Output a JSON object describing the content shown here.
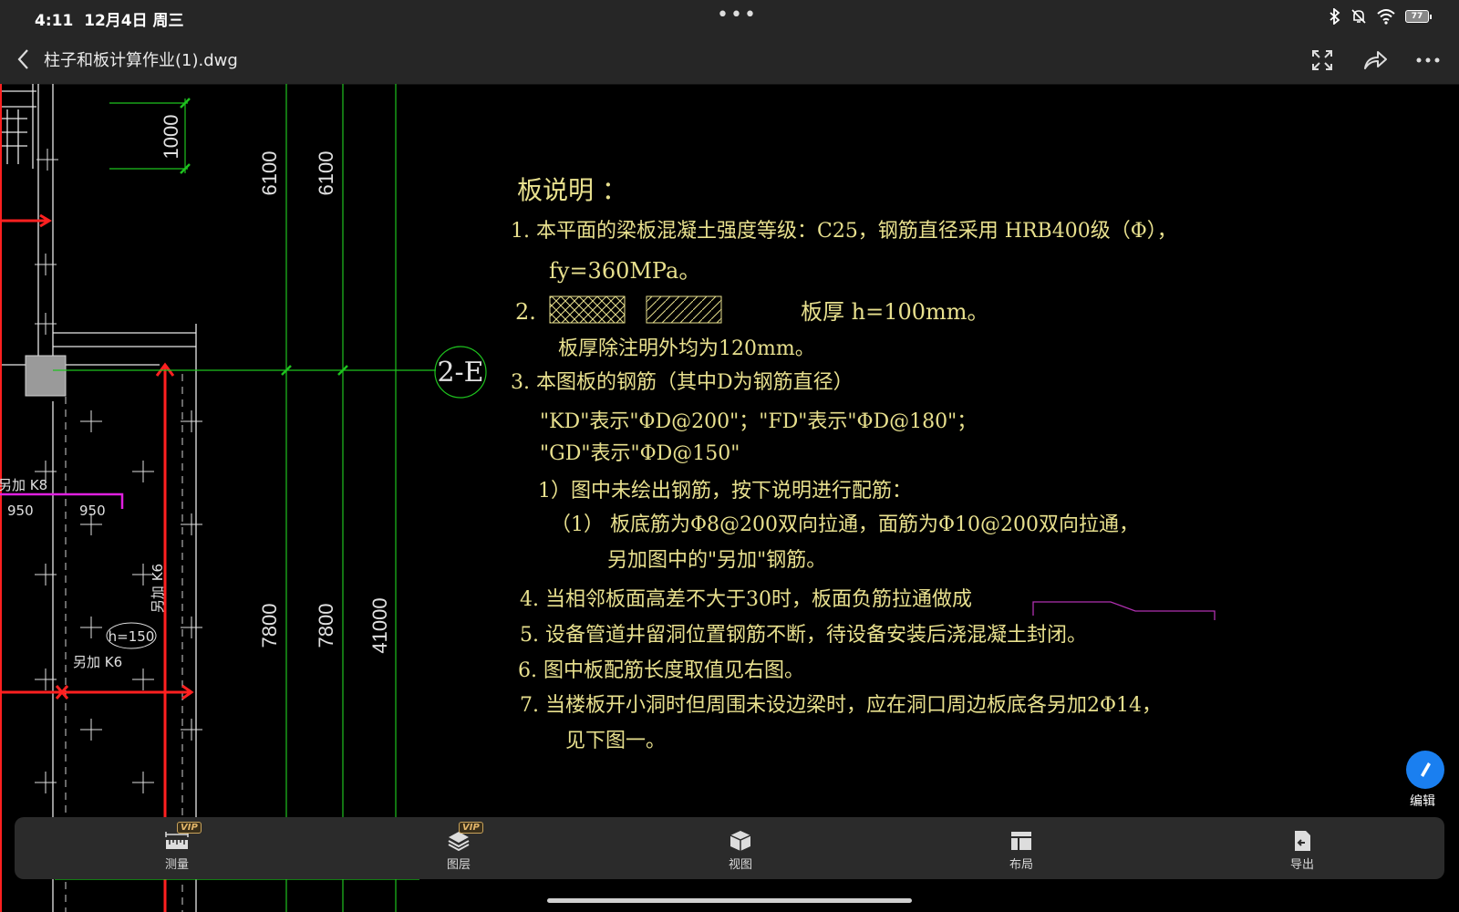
{
  "status_bar": {
    "time": "4:11",
    "date": "12月4日 周三",
    "dots": "•••",
    "battery": "77",
    "icons": [
      "bluetooth-icon",
      "mute-icon",
      "wifi-icon",
      "battery-icon"
    ]
  },
  "titlebar": {
    "file_name": "柱子和板计算作业(1).dwg",
    "actions": [
      "fullscreen-icon",
      "share-icon",
      "more-icon"
    ]
  },
  "drawing": {
    "dim_top": "1000",
    "dim_6100_a": "6100",
    "dim_6100_b": "6100",
    "dim_7800_a": "7800",
    "dim_7800_b": "7800",
    "dim_41000": "41000",
    "axis_label": "2-E",
    "label_k8": "另加 K8",
    "label_950_a": "950",
    "label_950_b": "950",
    "label_k6_v": "另加 K6",
    "label_h150": "h=150",
    "label_k6_h": "另加 K6",
    "colors": {
      "red": "#ff2020",
      "green": "#1ec21e",
      "magenta": "#e020e0",
      "yellow_text": "#e8e08e"
    }
  },
  "notes": {
    "title": "板说明 ：",
    "l1": "1.   本平面的梁板混凝土强度等级：C25，钢筋直径采用  HRB400级（Φ），",
    "l1b": "fy=360MPa。",
    "l2_num": "2.",
    "l2_text": "板厚  h=100mm。",
    "l2b": "板厚除注明外均为120mm。",
    "l3": "3.   本图板的钢筋（其中D为钢筋直径）",
    "l3a": "\"KD\"表示\"ΦD@200\"；\"FD\"表示\"ΦD@180\"；",
    "l3b": "\"GD\"表示\"ΦD@150\"",
    "l3c": "1）图中未绘出钢筋，按下说明进行配筋：",
    "l3d": "（1）  板底筋为Φ8@200双向拉通，面筋为Φ10@200双向拉通，",
    "l3e": "另加图中的\"另加\"钢筋。",
    "l4": "4.   当相邻板面高差不大于30时，板面负筋拉通做成",
    "l5": "5.   设备管道井留洞位置钢筋不断，待设备安装后浇混凝土封闭。",
    "l6": "6.   图中板配筋长度取值见右图。",
    "l7": "7.   当楼板开小洞时但周围未设边梁时，应在洞口周边板底各另加2Φ14，",
    "l7b": "见下图一。"
  },
  "edit_button": {
    "label": "编辑"
  },
  "bottom_bar": {
    "items": [
      {
        "label": "测量",
        "icon": "ruler-icon",
        "vip": "VIP"
      },
      {
        "label": "图层",
        "icon": "layers-icon",
        "vip": "VIP"
      },
      {
        "label": "视图",
        "icon": "cube-icon"
      },
      {
        "label": "布局",
        "icon": "layout-icon"
      },
      {
        "label": "导出",
        "icon": "export-icon"
      }
    ]
  }
}
